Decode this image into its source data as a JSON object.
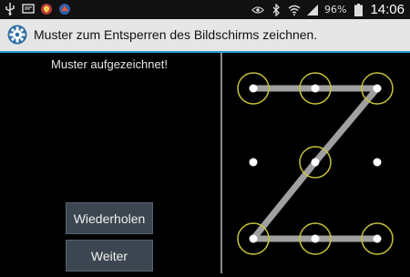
{
  "statusbar": {
    "left_icons": [
      "usb-icon",
      "message-icon",
      "shield-app-icon",
      "browser-app-icon"
    ],
    "right_icons": [
      "eye-icon",
      "bluetooth-icon",
      "wifi-icon",
      "signal-icon",
      "battery-icon"
    ],
    "battery": "96%",
    "time": "14:06"
  },
  "header": {
    "icon": "gear-icon",
    "title": "Muster zum Entsperren des Bildschirms zeichnen."
  },
  "main": {
    "message": "Muster aufgezeichnet!",
    "retry_label": "Wiederholen",
    "next_label": "Weiter"
  },
  "pattern": {
    "grid": "3x3",
    "sequence": [
      1,
      2,
      3,
      5,
      7,
      8,
      9
    ],
    "colors": {
      "ring": "#c8c23a",
      "line": "#a0a0a0",
      "dot": "#ffffff"
    }
  }
}
